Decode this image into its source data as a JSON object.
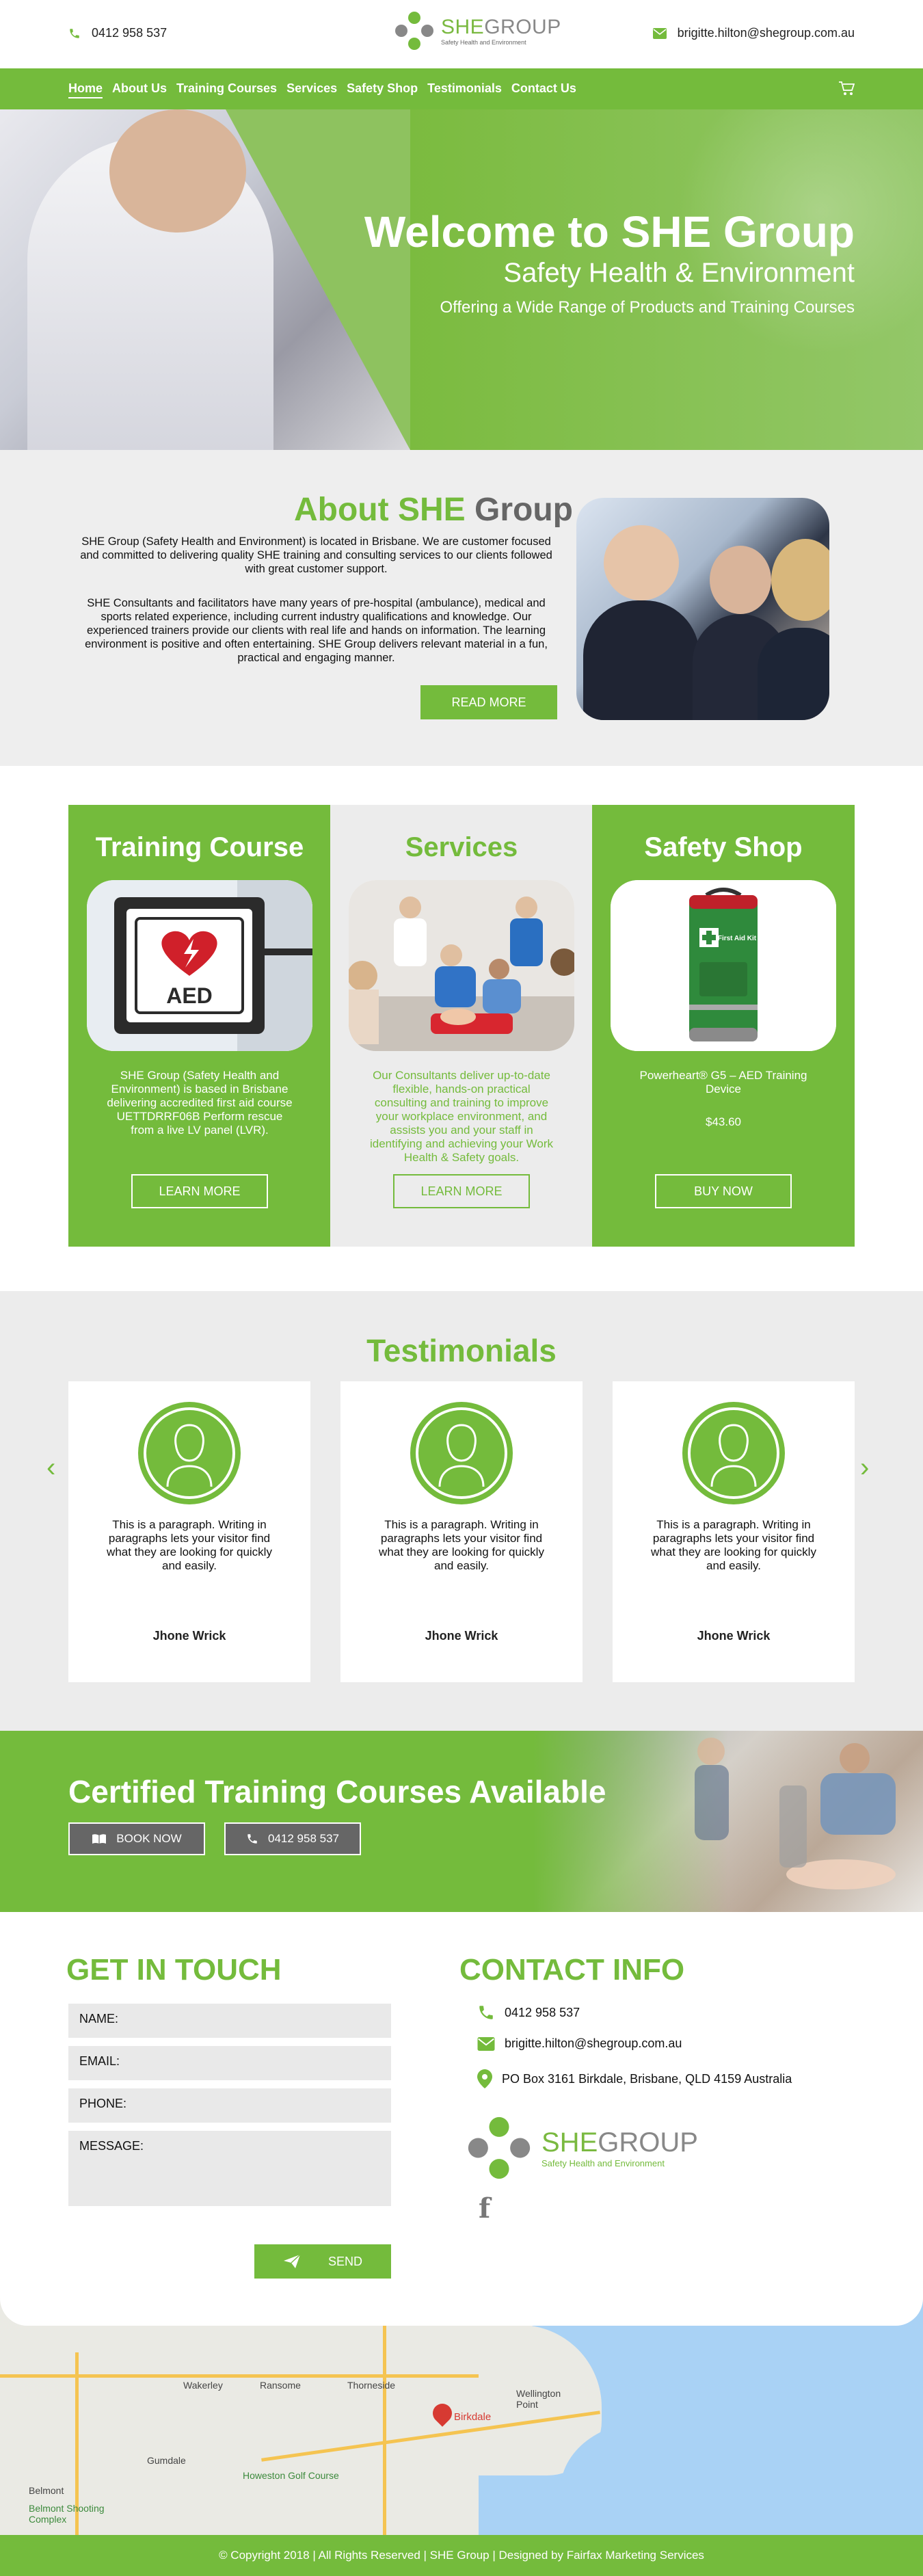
{
  "header": {
    "phone": "0412 958 537",
    "email": "brigitte.hilton@shegroup.com.au",
    "logo_she": "SHE",
    "logo_group": "GROUP",
    "logo_tagline": "Safety Health and Environment"
  },
  "nav": {
    "items": [
      "Home",
      "About Us",
      "Training Courses",
      "Services",
      "Safety Shop",
      "Testimonials",
      "Contact Us"
    ],
    "active": "Home"
  },
  "hero": {
    "title": "Welcome to SHE Group",
    "subtitle": "Safety Health & Environment",
    "tagline": "Offering a Wide Range of Products and Training Courses"
  },
  "about": {
    "title_part1": "About SHE",
    "title_part2": "Group",
    "para1": "SHE Group (Safety Health and Environment) is located in Brisbane. We are customer focused and committed to delivering quality SHE training and consulting services to our clients followed with great customer support.",
    "para2": "SHE Consultants and facilitators have many years of pre-hospital (ambulance), medical and sports related experience, including current industry qualifications and knowledge. Our experienced trainers provide our clients with real life and hands on information. The learning environment is positive and often entertaining. SHE Group delivers relevant material in a fun, practical and engaging manner.",
    "read_more": "READ MORE"
  },
  "columns": [
    {
      "title": "Training Course",
      "desc": "SHE Group (Safety Health and Environment) is based in Brisbane delivering accredited first aid course UETTDRRF06B Perform rescue from a live LV panel (LVR).",
      "button": "LEARN MORE"
    },
    {
      "title": "Services",
      "desc": "Our Consultants deliver up-to-date flexible, hands-on practical consulting and training to improve your workplace environment, and assists you and your staff in identifying and achieving your Work Health & Safety goals.",
      "button": "LEARN MORE"
    },
    {
      "title": "Safety Shop",
      "desc": "Powerheart® G5 – AED Training Device",
      "price": "$43.60",
      "button": "BUY NOW"
    }
  ],
  "aed_sign": "AED",
  "first_aid_kit_label": "First Aid Kit",
  "testimonials": {
    "title": "Testimonials",
    "cards": [
      {
        "quote": "This is a paragraph. Writing in paragraphs lets your visitor find what they are looking for quickly and easily.",
        "name": "Jhone Wrick"
      },
      {
        "quote": "This is a paragraph. Writing in paragraphs lets your visitor find what they are looking for quickly and easily.",
        "name": "Jhone Wrick"
      },
      {
        "quote": "This is a paragraph. Writing in paragraphs lets your visitor find what they are looking for quickly and easily.",
        "name": "Jhone Wrick"
      }
    ]
  },
  "cta": {
    "title": "Certified Training Courses Available",
    "book_now": "BOOK NOW",
    "phone": "0412 958 537"
  },
  "get_in_touch": {
    "title": "GET IN TOUCH",
    "name_label": "NAME:",
    "email_label": "EMAIL:",
    "phone_label": "PHONE:",
    "message_label": "MESSAGE:",
    "send": "SEND"
  },
  "contact_info": {
    "title": "CONTACT INFO",
    "phone": "0412 958 537",
    "email": "brigitte.hilton@shegroup.com.au",
    "address": "PO Box 3161 Birkdale, Brisbane, QLD 4159 Australia",
    "logo_she": "SHE",
    "logo_group": "GROUP",
    "logo_tagline": "Safety Health and Environment",
    "facebook": "f"
  },
  "map": {
    "labels": [
      "Wakerley",
      "Ransome",
      "Thorneside",
      "Wellington Point",
      "Gumdale",
      "Belmont",
      "Belmont Shooting Complex"
    ],
    "green_label": "Howeston Golf Course",
    "pin_label": "Birkdale"
  },
  "footer": {
    "text": "© Copyright 2018 | All Rights Reserved | SHE Group | Designed by Fairfax Marketing Services"
  },
  "colors": {
    "brand_green": "#74bb3c",
    "light_grey": "#ececec",
    "button_grey": "#666666"
  }
}
